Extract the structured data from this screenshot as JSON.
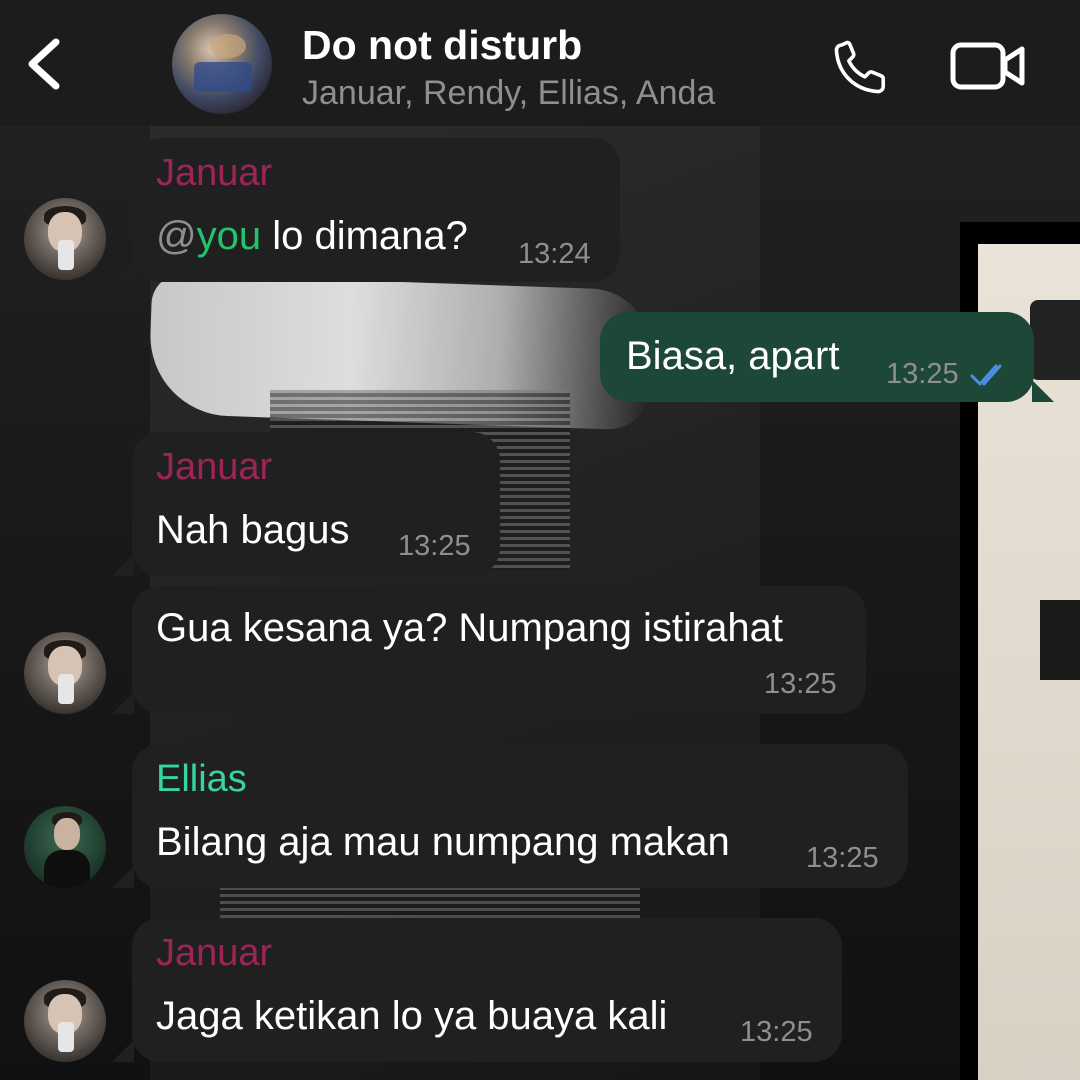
{
  "header": {
    "back_icon": "chevron-left-icon",
    "title": "Do not disturb",
    "subtitle": "Januar, Rendy, Ellias, Anda",
    "call_icon": "phone-icon",
    "video_icon": "video-camera-icon"
  },
  "colors": {
    "header_bg": "#1c1c1c",
    "incoming_bubble": "#202020",
    "outgoing_bubble": "#1d4736",
    "sender_januar": "#9e2457",
    "sender_ellias": "#38d39f",
    "mention": "#25c26e",
    "timestamp": "#8e8e93",
    "read_ticks": "#4a90e2"
  },
  "messages": [
    {
      "sender": "Januar",
      "mention_prefix": "@",
      "mention_name": "you",
      "text": " lo dimana?",
      "time": "13:24"
    },
    {
      "sender": "",
      "text": "Biasa, apart",
      "time": "13:25",
      "status": "read"
    },
    {
      "sender": "Januar",
      "text": "Nah bagus",
      "time": "13:25"
    },
    {
      "sender": "",
      "text": "Gua kesana ya? Numpang istirahat",
      "time": "13:25"
    },
    {
      "sender": "Ellias",
      "text": "Bilang aja mau numpang makan",
      "time": "13:25"
    },
    {
      "sender": "Januar",
      "text": "Jaga ketikan lo ya buaya kali",
      "time": "13:25"
    }
  ]
}
